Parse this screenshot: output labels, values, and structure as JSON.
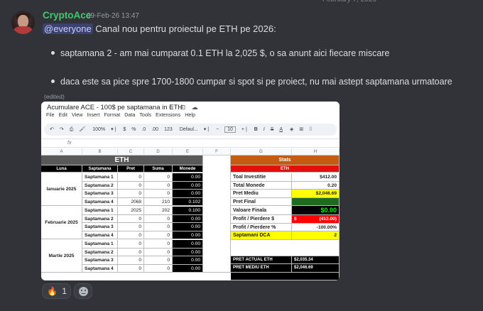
{
  "message": {
    "username": "CryptoAce",
    "timestamp": "09-Feb-26 13:47",
    "mention": "@everyone",
    "intro": " Canal nou pentru proiectul pe ETH pe 2026:",
    "bullets": [
      "saptamana 2 - am mai cumparat 0.1 ETH la 2,025 $, o sa anunt aici fiecare miscare",
      "daca este sa pice spre 1700-1800 cumpar si spot si pe proiect, nu mai astept saptamana urmatoare"
    ],
    "edited_label": "(edited)"
  },
  "sheet": {
    "doc_title": "Acumulare ACE - 100$ pe saptamana in ETH",
    "menu": [
      "File",
      "Edit",
      "View",
      "Insert",
      "Format",
      "Data",
      "Tools",
      "Extensions",
      "Help"
    ],
    "zoom": "100%",
    "font": "Defaul...",
    "font_size": "10",
    "fx": "fx",
    "col_letters": [
      "A",
      "B",
      "C",
      "D",
      "E",
      "F",
      "G",
      "H"
    ],
    "left_title": "ETH",
    "headers": [
      "Luna",
      "Saptamana",
      "Pret",
      "Suma",
      "Monede"
    ],
    "months": [
      {
        "name": "Ianuarie 2025",
        "rows": [
          {
            "week": "Saptamana 1",
            "pret": "0",
            "suma": "0",
            "monede": "0.00"
          },
          {
            "week": "Saptamana 2",
            "pret": "0",
            "suma": "0",
            "monede": "0.00"
          },
          {
            "week": "Saptamana 3",
            "pret": "0",
            "suma": "0",
            "monede": "0.00"
          },
          {
            "week": "Saptamana 4",
            "pret": "2068",
            "suma": "210",
            "monede": "0.102"
          }
        ]
      },
      {
        "name": "Februarie 2025",
        "rows": [
          {
            "week": "Saptamana 1",
            "pret": "2025",
            "suma": "202",
            "monede": "0.100"
          },
          {
            "week": "Saptamana 2",
            "pret": "0",
            "suma": "0",
            "monede": "0.00"
          },
          {
            "week": "Saptamana 3",
            "pret": "0",
            "suma": "0",
            "monede": "0.00"
          },
          {
            "week": "Saptamana 4",
            "pret": "0",
            "suma": "0",
            "monede": "0.00"
          }
        ]
      },
      {
        "name": "Martie 2025",
        "rows": [
          {
            "week": "Saptamana 1",
            "pret": "0",
            "suma": "0",
            "monede": "0.00"
          },
          {
            "week": "Saptamana 2",
            "pret": "0",
            "suma": "0",
            "monede": "0.00"
          },
          {
            "week": "Saptamana 3",
            "pret": "0",
            "suma": "0",
            "monede": "0.00"
          },
          {
            "week": "Saptamana 4",
            "pret": "0",
            "suma": "0",
            "monede": "0.00"
          }
        ]
      }
    ],
    "stats_title": "Stats",
    "stats_sub": "ETH",
    "stats": [
      {
        "label": "Toal Investitie",
        "value": "$412.00"
      },
      {
        "label": "Total Monede",
        "value": "0.20"
      },
      {
        "label": "Pret Mediu",
        "value": "$2,046.69"
      },
      {
        "label": "Pret Final",
        "value": ""
      },
      {
        "label": "Valoare Finala",
        "value": "$0.00"
      },
      {
        "label": "Profit / Pierdere $",
        "sign": "$",
        "value": "(412.00)"
      },
      {
        "label": "Profit / Pierdere %",
        "value": "-100.00%"
      },
      {
        "label": "Saptamani DCA",
        "value": "2"
      }
    ],
    "price_rows": [
      {
        "label": "PRET ACTUAL ETH",
        "value": "$2,035.34"
      },
      {
        "label": "PRET MEDIU ETH",
        "value": "$2,046.69"
      }
    ]
  },
  "reactions": [
    {
      "emoji": "🔥",
      "count": "1"
    }
  ]
}
